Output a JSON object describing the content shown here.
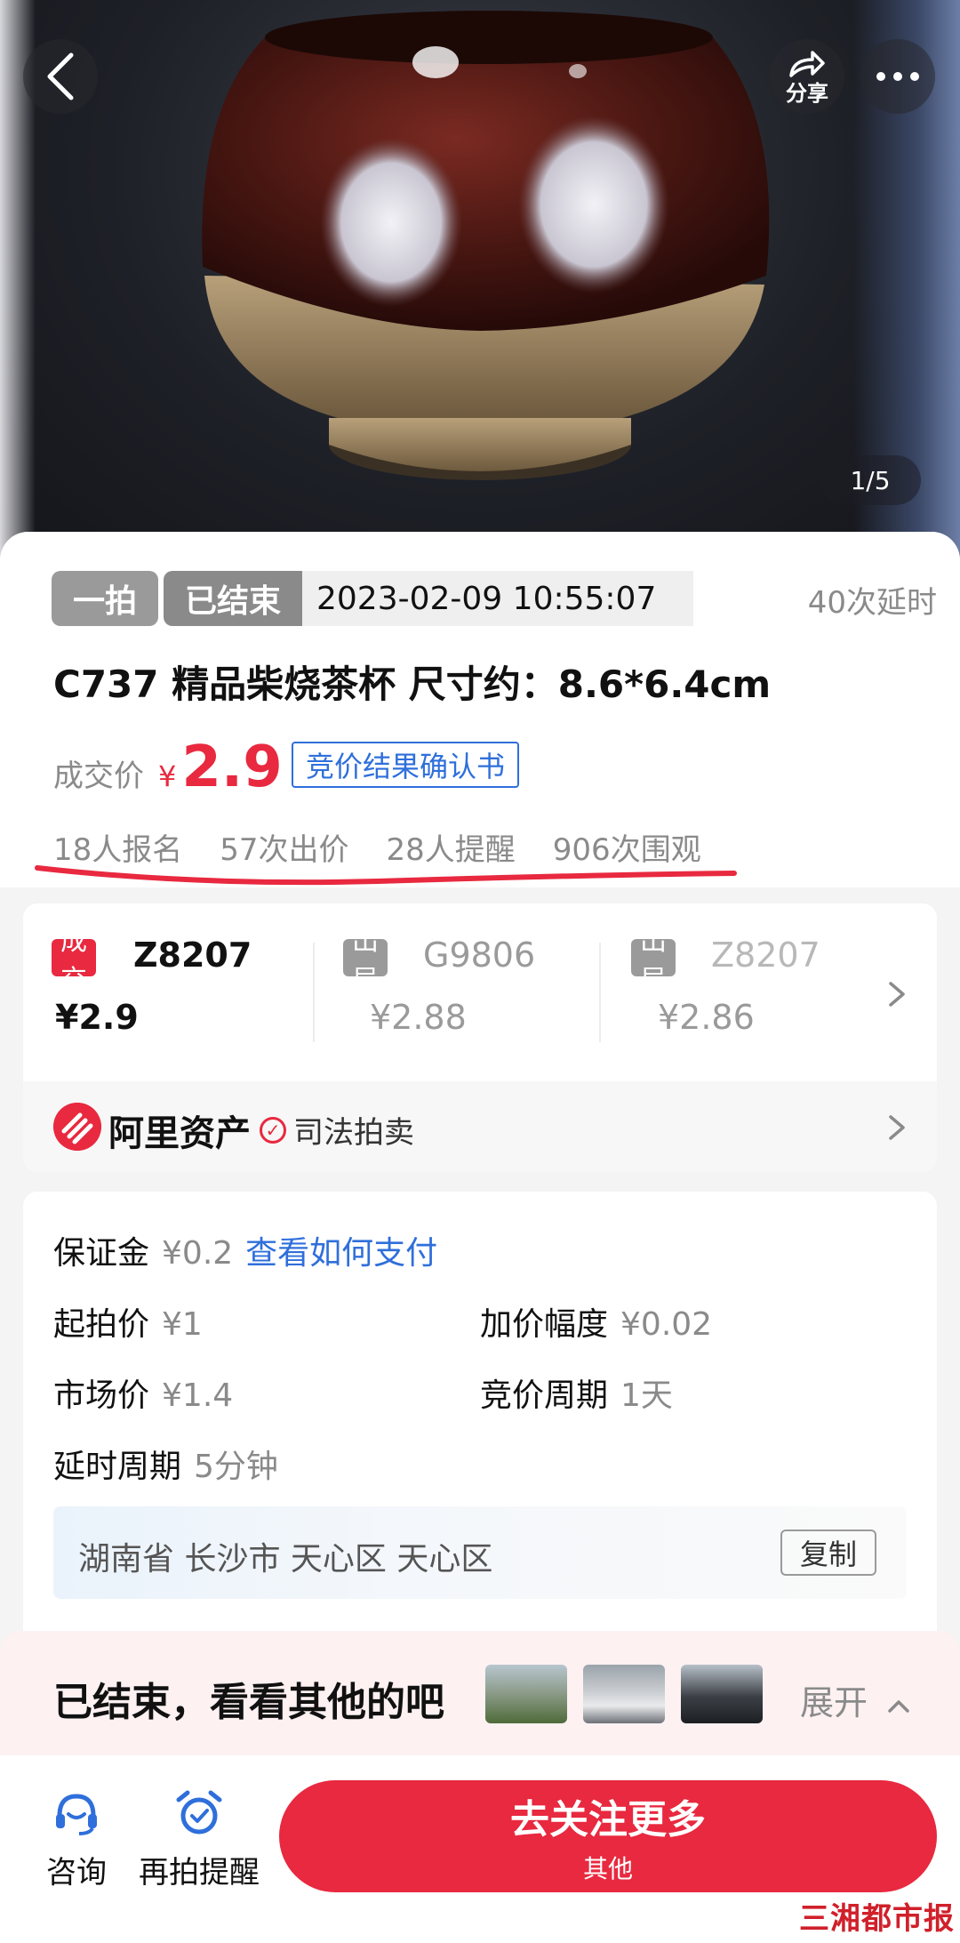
{
  "hero": {
    "share_label": "分享",
    "page_indicator": "1/5"
  },
  "auction": {
    "type_badge": "一拍",
    "status_badge": "已结束",
    "end_time": "2023-02-09 10:55:07",
    "delay_count": "40次延时",
    "title": "C737 精品柴烧茶杯 尺寸约：8.6*6.4cm",
    "price_label": "成交价",
    "currency": "¥",
    "final_price": "2.9",
    "certificate_link": "竞价结果确认书",
    "stats": {
      "signups": "18人报名",
      "bids": "57次出价",
      "reminders": "28人提醒",
      "views": "906次围观"
    }
  },
  "bidders": [
    {
      "tag": "成交",
      "name": "Z8207",
      "amount": "¥2.9"
    },
    {
      "tag": "出局",
      "name": "G9806",
      "amount": "¥2.88"
    },
    {
      "tag": "出局",
      "name": "Z8207",
      "amount": "¥2.86"
    }
  ],
  "platform": {
    "name": "阿里资产",
    "category": "司法拍卖"
  },
  "info": {
    "deposit_label": "保证金",
    "deposit_value": "¥0.2",
    "deposit_link": "查看如何支付",
    "start_price_label": "起拍价",
    "start_price_value": "¥1",
    "increment_label": "加价幅度",
    "increment_value": "¥0.02",
    "market_price_label": "市场价",
    "market_price_value": "¥1.4",
    "bid_period_label": "竞价周期",
    "bid_period_value": "1天",
    "delay_period_label": "延时周期",
    "delay_period_value": "5分钟",
    "address": "湖南省 长沙市 天心区 天心区",
    "copy_label": "复制"
  },
  "ended_banner": {
    "text": "已结束，看看其他的吧",
    "expand_label": "展开"
  },
  "bottom_bar": {
    "consult_label": "咨询",
    "remind_label": "再拍提醒",
    "cta_main": "去关注更多",
    "cta_sub": "其他"
  },
  "watermark": "三湘都市报",
  "colors": {
    "accent_red": "#e8293f",
    "link_blue": "#2f6fdb",
    "muted_gray": "#8a8a8a"
  }
}
